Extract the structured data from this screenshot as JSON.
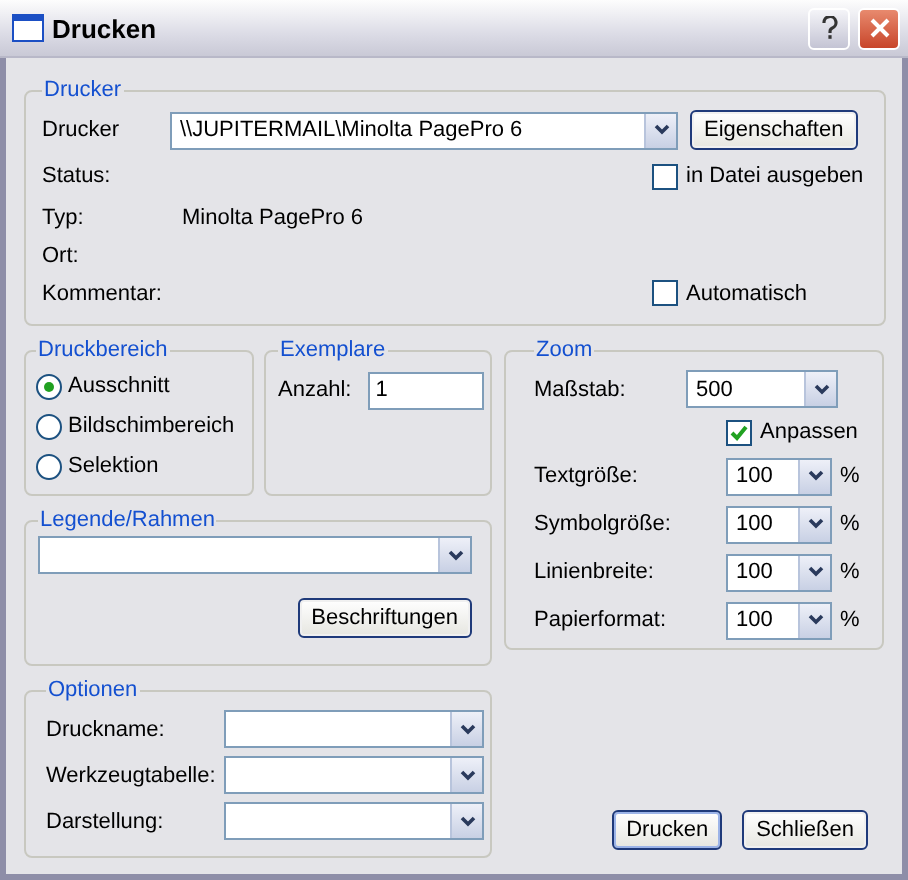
{
  "window": {
    "title": "Drucken"
  },
  "printer": {
    "title": "Drucker",
    "label": "Drucker",
    "value": "\\\\JUPITERMAIL\\Minolta PagePro 6",
    "properties_button": "Eigenschaften",
    "info": [
      {
        "label": "Status:",
        "checkbox": {
          "label": "in Datei ausgeben",
          "checked": false
        }
      },
      {
        "label": "Typ:",
        "value": "Minolta PagePro 6"
      },
      {
        "label": "Ort:"
      },
      {
        "label": "Kommentar:",
        "checkbox": {
          "label": "Automatisch",
          "checked": false
        }
      }
    ]
  },
  "print_range": {
    "title": "Druckbereich",
    "options": [
      {
        "label": "Ausschnitt",
        "selected": true
      },
      {
        "label": "Bildschimbereich",
        "selected": false
      },
      {
        "label": "Selektion",
        "selected": false
      }
    ]
  },
  "copies": {
    "title": "Exemplare",
    "label": "Anzahl:",
    "value": "1"
  },
  "legend_frame": {
    "title": "Legende/Rahmen",
    "button": "Beschriftungen"
  },
  "zoom": {
    "title": "Zoom",
    "scale": {
      "label": "Maßstab:",
      "value": "500"
    },
    "fit": {
      "label": "Anpassen",
      "checked": true
    },
    "rows": [
      {
        "label": "Textgröße:",
        "value": "100",
        "unit": "%"
      },
      {
        "label": "Symbolgröße:",
        "value": "100",
        "unit": "%"
      },
      {
        "label": "Linienbreite:",
        "value": "100",
        "unit": "%"
      },
      {
        "label": "Papierformat:",
        "value": "100",
        "unit": "%"
      }
    ]
  },
  "options": {
    "title": "Optionen",
    "rows": [
      {
        "label": "Druckname:"
      },
      {
        "label": "Werkzeugtabelle:"
      },
      {
        "label": "Darstellung:"
      }
    ]
  },
  "buttons": [
    {
      "label": "Drucken",
      "default": true
    },
    {
      "label": "Schließen",
      "default": false
    }
  ]
}
